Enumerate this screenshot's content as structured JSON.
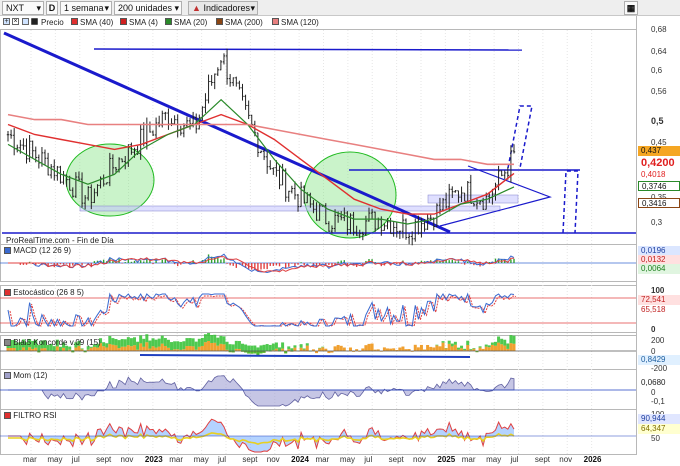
{
  "toolbar": {
    "ticker": "NXT",
    "d_badge": "D",
    "interval": "1 semana",
    "units": "200 unidades",
    "indicators": "Indicadores",
    "calendar_icon": "calendar-icon"
  },
  "legend": {
    "precio": "Precio",
    "sma40": "SMA (40)",
    "sma4": "SMA (4)",
    "sma20": "SMA (20)",
    "sma200": "SMA (200)",
    "sma120": "SMA (120)"
  },
  "source": "ProRealTime.com - Fin de Día",
  "panels": {
    "macd": "MACD (12 26 9)",
    "stoch": "Estocástico (26 8 5)",
    "konc": "Blai5 Koncorde v.09 (15)",
    "mom": "Mom (12)",
    "rsi": "FILTRO RSI"
  },
  "colors": {
    "price": "#222222",
    "sma40": "#e03030",
    "sma4": "#d02020",
    "sma20": "#2a8a2a",
    "sma200": "#8b4513",
    "sma120": "#e88080",
    "trend": "#1a1acc",
    "circle_fill": "#66dd66",
    "circle_stroke": "#22bb22"
  },
  "price_axis": {
    "ticks": [
      "0,68",
      "0,64",
      "0,6",
      "0,56",
      "0,5",
      "0,45",
      "0,4",
      "0,35",
      "0,3"
    ],
    "badges": [
      "0,437",
      "0,4200",
      "0,4018",
      "0,3746",
      "0,3416"
    ]
  },
  "macd_axis": {
    "badges": [
      "0,0196",
      "0,0132",
      "0,0064"
    ]
  },
  "stoch_axis": {
    "ticks": [
      "100",
      "0"
    ],
    "badges": [
      "72,541",
      "65,518"
    ]
  },
  "konc_axis": {
    "ticks": [
      "200",
      "0",
      "-200"
    ],
    "badges": [
      "0,8429"
    ]
  },
  "mom_axis": {
    "ticks": [
      "0",
      "-0,1"
    ],
    "badges": [
      "0,0680"
    ]
  },
  "rsi_axis": {
    "ticks": [
      "100",
      "50"
    ],
    "badges": [
      "90,944",
      "64,347"
    ]
  },
  "x_axis": {
    "labels": [
      "mar",
      "may",
      "jul",
      "sept",
      "nov",
      "2023",
      "mar",
      "may",
      "jul",
      "sept",
      "nov",
      "2024",
      "mar",
      "may",
      "jul",
      "sept",
      "nov",
      "2025",
      "mar",
      "may",
      "jul",
      "sept",
      "nov",
      "2026"
    ]
  },
  "chart_data": {
    "type": "line",
    "title": "NXT",
    "subtitle": "1 semana",
    "xlabel": "",
    "ylabel": "",
    "ylim": [
      0.28,
      0.69
    ],
    "x": [
      "2022-03",
      "2022-05",
      "2022-07",
      "2022-09",
      "2022-11",
      "2023-01",
      "2023-03",
      "2023-05",
      "2023-07",
      "2023-09",
      "2023-11",
      "2024-01",
      "2024-03",
      "2024-05",
      "2024-07",
      "2024-09",
      "2024-11",
      "2025-01",
      "2025-03",
      "2025-05"
    ],
    "series": [
      {
        "name": "Precio",
        "values": [
          0.48,
          0.44,
          0.4,
          0.35,
          0.42,
          0.47,
          0.52,
          0.49,
          0.64,
          0.51,
          0.4,
          0.35,
          0.31,
          0.3,
          0.31,
          0.29,
          0.32,
          0.37,
          0.35,
          0.437
        ]
      },
      {
        "name": "SMA (40)",
        "values": [
          0.5,
          0.48,
          0.47,
          0.46,
          0.45,
          0.46,
          0.48,
          0.5,
          0.52,
          0.5,
          0.47,
          0.43,
          0.39,
          0.35,
          0.33,
          0.32,
          0.32,
          0.34,
          0.36,
          0.4018
        ]
      },
      {
        "name": "SMA (20)",
        "values": [
          0.46,
          0.43,
          0.4,
          0.38,
          0.4,
          0.45,
          0.48,
          0.5,
          0.55,
          0.5,
          0.43,
          0.37,
          0.33,
          0.31,
          0.31,
          0.3,
          0.31,
          0.34,
          0.35,
          0.3746
        ]
      },
      {
        "name": "SMA (120)",
        "values": [
          0.52,
          0.51,
          0.51,
          0.5,
          0.5,
          0.5,
          0.5,
          0.5,
          0.5,
          0.5,
          0.49,
          0.48,
          0.47,
          0.46,
          0.45,
          0.44,
          0.43,
          0.43,
          0.42,
          0.42
        ]
      }
    ]
  }
}
